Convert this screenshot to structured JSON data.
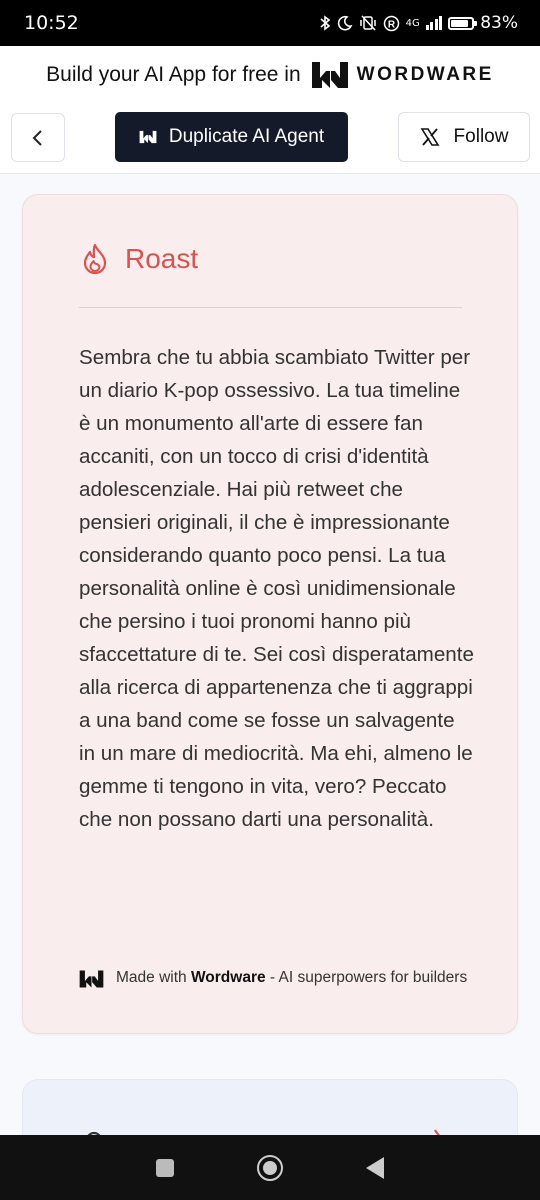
{
  "status_bar": {
    "time": "10:52",
    "network": "4G",
    "battery_pct_label": "83%",
    "battery_level": 0.83
  },
  "banner": {
    "text": "Build your AI App for free in",
    "brand": "WORDWARE"
  },
  "actions": {
    "duplicate_label": "Duplicate AI Agent",
    "follow_label": "Follow"
  },
  "roast_card": {
    "title": "Roast",
    "body": "Sembra che tu abbia scambiato Twitter per un diario K-pop ossessivo. La tua timeline è un monumento all'arte di essere fan accaniti, con un tocco di crisi d'identità adolescenziale. Hai più retweet che pensieri originali, il che è impressionante considerando quanto poco pensi. La tua personalità online è così unidimensionale che persino i tuoi pronomi hanno più sfaccettature di te. Sei così disperatamente alla ricerca di appartenenza che ti aggrappi a una band come se fosse un salvagente in un mare di mediocrità. Ma ehi, almeno le gemme ti tengono in vita, vero? Peccato che non possano darti una personalità.",
    "made_with_prefix": "Made with ",
    "made_with_brand": "Wordware",
    "made_with_suffix": " - AI superpowers for builders"
  },
  "colors": {
    "accent_red": "#d9534f",
    "dark_button": "#141a2a",
    "card_bg": "#f9eded"
  }
}
